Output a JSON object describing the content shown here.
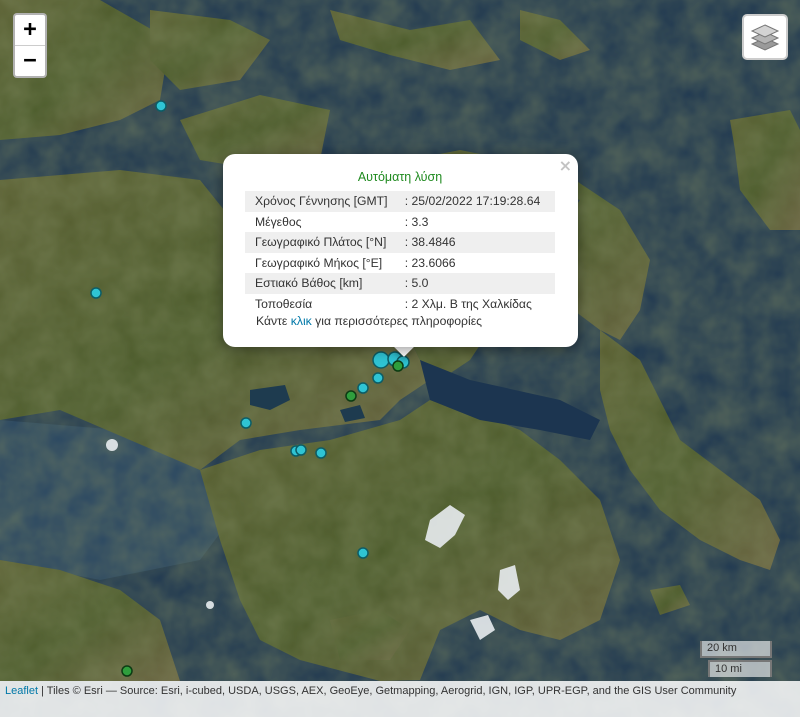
{
  "map": {
    "zoom_in": "+",
    "zoom_out": "−",
    "layers_icon": "layers-icon",
    "colors": {
      "sea": "#1c3550",
      "land": "#4f5a2c",
      "marker_cyan": "#2fc4d4",
      "marker_green": "#2f9e3d",
      "popup_title": "#1f8a1f",
      "link": "#0078a8"
    }
  },
  "popup": {
    "title": "Αυτόματη λύση",
    "close": "×",
    "rows": [
      {
        "label": "Χρόνος Γέννησης [GMT]",
        "value": ": 25/02/2022 17:19:28.64"
      },
      {
        "label": "Μέγεθος",
        "value": ": 3.3"
      },
      {
        "label": "Γεωγραφικό Πλάτος [°N]",
        "value": ": 38.4846"
      },
      {
        "label": "Γεωγραφικό Μήκος [°E]",
        "value": ": 23.6066"
      },
      {
        "label": "Εστιακό Βάθος [km]",
        "value": ": 5.0"
      },
      {
        "label": "Τοποθεσία",
        "value": ": 2 Χλμ. Β της Χαλκίδας"
      }
    ],
    "more_prefix": "Κάντε ",
    "more_link": "κλικ",
    "more_suffix": " για περισσότερες πληροφορίες"
  },
  "scale": {
    "km": "20 km",
    "mi": "10 mi"
  },
  "attribution": {
    "leaflet": "Leaflet",
    "text": " | Tiles © Esri — Source: Esri, i-cubed, USDA, USGS, AEX, GeoEye, Getmapping, Aerogrid, IGN, IGP, UPR-EGP, and the GIS User Community"
  }
}
